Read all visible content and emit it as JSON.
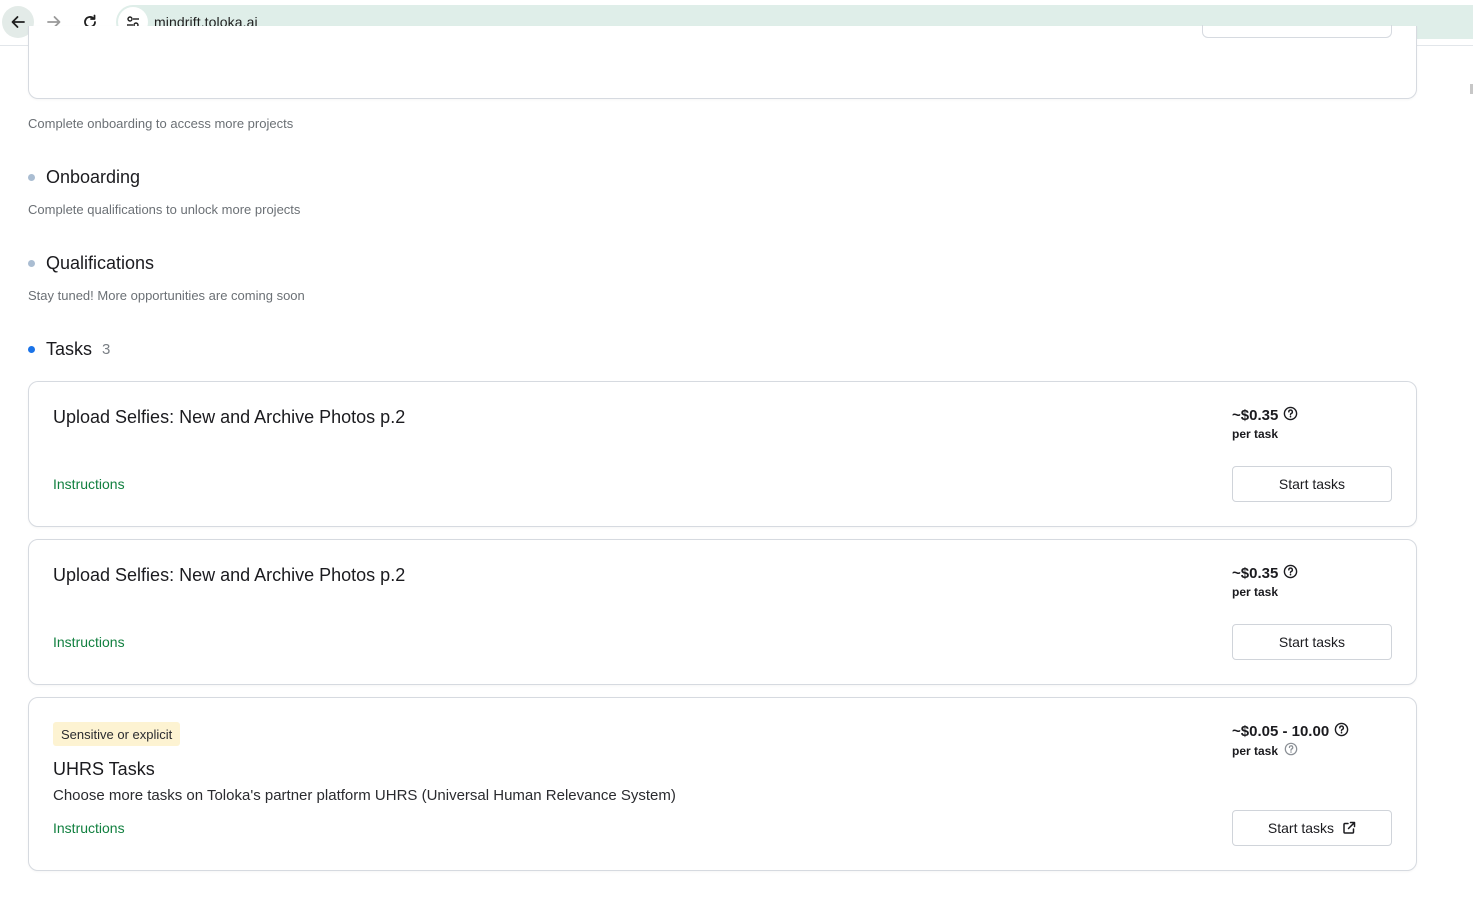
{
  "browser": {
    "url": "mindrift.toloka.ai"
  },
  "notes": {
    "onboarding_hint": "Complete onboarding to access more projects",
    "qualifications_hint": "Complete qualifications to unlock more projects",
    "stay_tuned": "Stay tuned! More opportunities are coming soon"
  },
  "sections": {
    "onboarding": "Onboarding",
    "qualifications": "Qualifications",
    "tasks": "Tasks",
    "tasks_count": "3"
  },
  "tasks": [
    {
      "title": "Upload Selfies: New and Archive Photos p.2",
      "price": "~$0.35",
      "per": "per task",
      "instructions": "Instructions",
      "button": "Start tasks"
    },
    {
      "title": "Upload Selfies: New and Archive Photos p.2",
      "price": "~$0.35",
      "per": "per task",
      "instructions": "Instructions",
      "button": "Start tasks"
    },
    {
      "badge": "Sensitive or explicit",
      "title": "UHRS Tasks",
      "description": "Choose more tasks on Toloka's partner platform UHRS (Universal Human Relevance System)",
      "price": "~$0.05 - 10.00",
      "per": "per task",
      "instructions": "Instructions",
      "button": "Start tasks",
      "button_icon": "external-link-icon"
    }
  ],
  "colors": {
    "accent_green": "#128040",
    "active_bullet": "#1a73e8",
    "inactive_bullet": "#aabdd2",
    "badge_bg": "#fdf3d2",
    "omnibox_bg": "#dfeee9"
  }
}
